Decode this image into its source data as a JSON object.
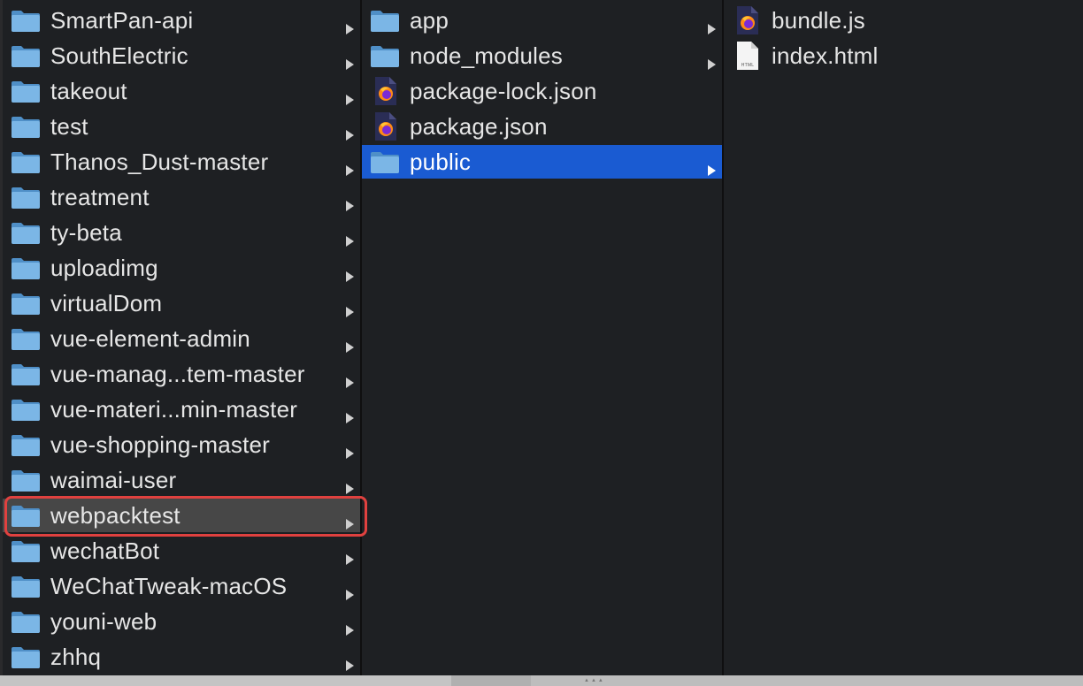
{
  "columns": {
    "left": {
      "items": [
        {
          "label": "SmartPan-api",
          "type": "folder"
        },
        {
          "label": "SouthElectric",
          "type": "folder"
        },
        {
          "label": "takeout",
          "type": "folder"
        },
        {
          "label": "test",
          "type": "folder"
        },
        {
          "label": "Thanos_Dust-master",
          "type": "folder"
        },
        {
          "label": "treatment",
          "type": "folder"
        },
        {
          "label": "ty-beta",
          "type": "folder"
        },
        {
          "label": "uploadimg",
          "type": "folder"
        },
        {
          "label": "virtualDom",
          "type": "folder"
        },
        {
          "label": "vue-element-admin",
          "type": "folder"
        },
        {
          "label": "vue-manag...tem-master",
          "type": "folder"
        },
        {
          "label": "vue-materi...min-master",
          "type": "folder"
        },
        {
          "label": "vue-shopping-master",
          "type": "folder"
        },
        {
          "label": "waimai-user",
          "type": "folder"
        },
        {
          "label": "webpacktest",
          "type": "folder",
          "selected": true
        },
        {
          "label": "wechatBot",
          "type": "folder"
        },
        {
          "label": "WeChatTweak-macOS",
          "type": "folder"
        },
        {
          "label": "youni-web",
          "type": "folder"
        },
        {
          "label": "zhhq",
          "type": "folder"
        }
      ]
    },
    "middle": {
      "items": [
        {
          "label": "app",
          "type": "folder"
        },
        {
          "label": "node_modules",
          "type": "folder"
        },
        {
          "label": "package-lock.json",
          "type": "firefox-doc"
        },
        {
          "label": "package.json",
          "type": "firefox-doc"
        },
        {
          "label": "public",
          "type": "folder",
          "selected": true
        }
      ]
    },
    "right": {
      "items": [
        {
          "label": "bundle.js",
          "type": "firefox-doc"
        },
        {
          "label": "index.html",
          "type": "html-doc",
          "badge": "HTML"
        }
      ]
    }
  },
  "colors": {
    "background": "#1e2023",
    "folder": "#6aa8dc",
    "selection_active": "#1a5bd2",
    "selection_inactive": "#474747",
    "highlight_border": "#e0413f"
  }
}
